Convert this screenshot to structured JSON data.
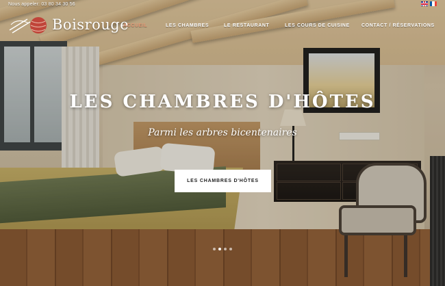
{
  "header": {
    "phone_text": "Nous appeler: 03 80 34 30 56",
    "brand_name": "Boisrouge",
    "nav": [
      {
        "label": "ACCUEIL",
        "active": true
      },
      {
        "label": "LES CHAMBRES",
        "active": false
      },
      {
        "label": "LE RESTAURANT",
        "active": false
      },
      {
        "label": "LES COURS DE CUISINE",
        "active": false
      },
      {
        "label": "CONTACT / RÉSERVATIONS",
        "active": false
      }
    ],
    "languages": [
      "en-flag-icon",
      "fr-flag-icon"
    ]
  },
  "hero": {
    "title": "LES CHAMBRES D'HÔTES",
    "subtitle": "Parmi les arbres bicentenaires",
    "cta_label": "LES CHAMBRES D'HÔTES",
    "slides": [
      {
        "active": false
      },
      {
        "active": true
      },
      {
        "active": false
      },
      {
        "active": false
      }
    ]
  },
  "colors": {
    "accent": "#e89a76",
    "text_on_image": "#ffffff",
    "logo_mark": "#c0453a"
  }
}
